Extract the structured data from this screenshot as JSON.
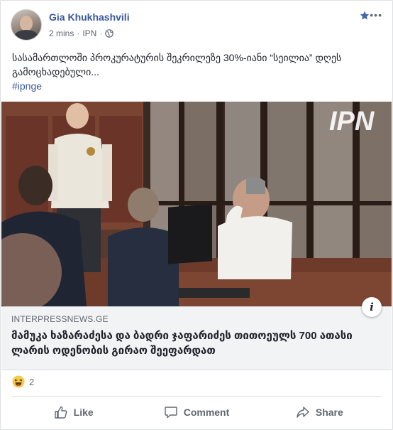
{
  "post": {
    "author": "Gia Khukhashvili",
    "time": "2 mins",
    "separator": "·",
    "source": "IPN",
    "text": "სასამართლოში პროკურატურის შეკრილეზე 30%-იანი “სეილია” დღეს გამოცხადებული...",
    "hashtag": "#ipnge"
  },
  "photo": {
    "watermark": "IPN",
    "colors": {
      "wood": "#6b3a2a",
      "shirt_white": "#f2f0ec",
      "suit": "#232b3d"
    }
  },
  "link": {
    "source": "INTERPRESSNEWS.GE",
    "title": "მამუკა ხაზარაძესა და ბადრი ჯაფარიძეს თითოეულს 700 ათასი ლარის ოდენობის გირაო შეეფარდათ",
    "info_icon_label": "i"
  },
  "reactions": {
    "icon": "haha-icon",
    "count": "2"
  },
  "actions": {
    "like": "Like",
    "comment": "Comment",
    "share": "Share"
  },
  "colors": {
    "link_blue": "#385898",
    "secondary": "#606770",
    "star_blue": "#4267b2"
  }
}
